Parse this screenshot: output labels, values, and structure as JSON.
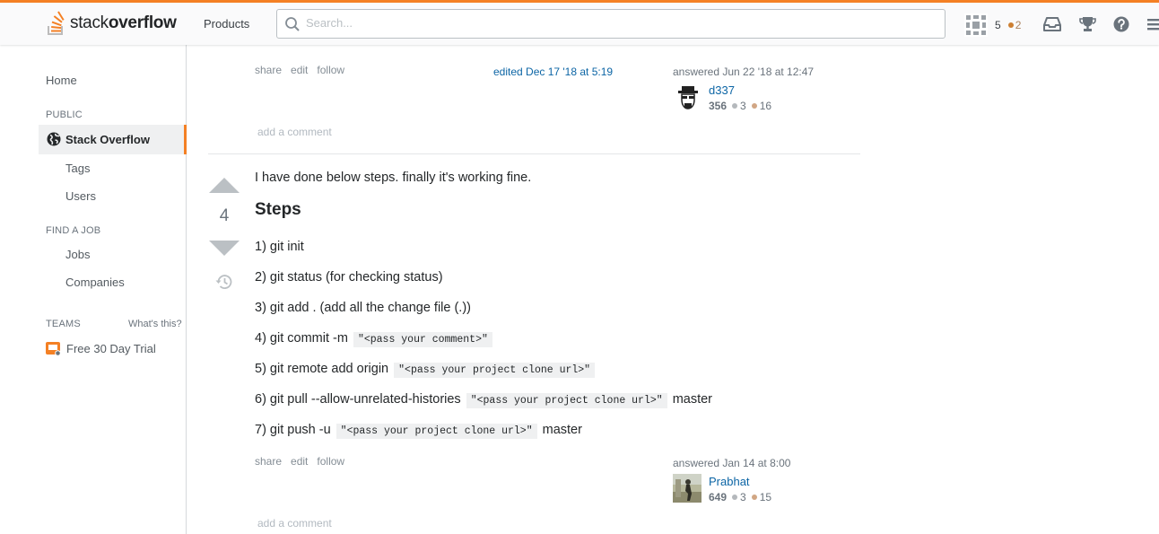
{
  "brand": {
    "logo_text_light": "stack",
    "logo_text_bold": "overflow",
    "accent": "#f48024"
  },
  "topbar": {
    "products_label": "Products",
    "search_placeholder": "Search...",
    "reputation": "5",
    "bronze_badges": "2"
  },
  "sidebar": {
    "home": "Home",
    "public_heading": "PUBLIC",
    "stack_overflow": "Stack Overflow",
    "tags": "Tags",
    "users": "Users",
    "find_job_heading": "FIND A JOB",
    "jobs": "Jobs",
    "companies": "Companies",
    "teams_heading": "TEAMS",
    "whats_this": "What's this?",
    "free_trial": "Free 30 Day Trial"
  },
  "answer1": {
    "menu": [
      "share",
      "edit",
      "follow"
    ],
    "edited": "edited Dec 17 '18 at 5:19",
    "answered": "answered Jun 22 '18 at 12:47",
    "user": "d337",
    "rep": "356",
    "silver": "3",
    "bronze": "16",
    "add_comment": "add a comment"
  },
  "answer2": {
    "votes": "4",
    "intro": "I have done below steps. finally it's working fine.",
    "heading": "Steps",
    "steps": [
      {
        "text": "1) git init",
        "code": "",
        "after": ""
      },
      {
        "text": "2) git status (for checking status)",
        "code": "",
        "after": ""
      },
      {
        "text": "3) git add . (add all the change file (.))",
        "code": "",
        "after": ""
      },
      {
        "text": "4) git commit -m",
        "code": "\"<pass your comment>\"",
        "after": ""
      },
      {
        "text": "5) git remote add origin",
        "code": "\"<pass your project clone url>\"",
        "after": ""
      },
      {
        "text": "6) git pull --allow-unrelated-histories",
        "code": "\"<pass your project clone url>\"",
        "after": "master"
      },
      {
        "text": "7) git push -u",
        "code": "\"<pass your project clone url>\"",
        "after": "master"
      }
    ],
    "menu": [
      "share",
      "edit",
      "follow"
    ],
    "answered": "answered Jan 14 at 8:00",
    "user": "Prabhat",
    "rep": "649",
    "silver": "3",
    "bronze": "15",
    "add_comment": "add a comment"
  }
}
